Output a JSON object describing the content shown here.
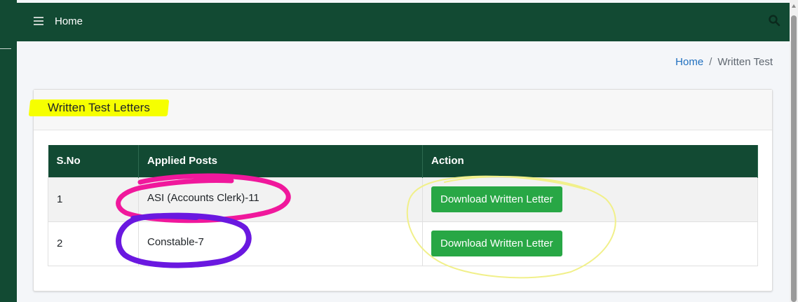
{
  "header": {
    "home_label": "Home"
  },
  "breadcrumb": {
    "home": "Home",
    "separator": "/",
    "current": "Written Test"
  },
  "card": {
    "title": "Written Test Letters",
    "table": {
      "columns": [
        "S.No",
        "Applied Posts",
        "Action"
      ],
      "rows": [
        {
          "sno": "1",
          "post": "ASI (Accounts Clerk)-11",
          "action": "Download Written Letter"
        },
        {
          "sno": "2",
          "post": "Constable-7",
          "action": "Download Written Letter"
        }
      ]
    }
  },
  "colors": {
    "primary_green": "#124a33",
    "button_green": "#28a745",
    "link_blue": "#1f6fbf",
    "highlight_yellow": "#f6ff00",
    "annotation_pink": "#f0189c",
    "annotation_purple": "#6a18e0",
    "annotation_yellow": "#f1f08a"
  },
  "icons": {
    "menu": "hamburger-menu-icon",
    "search": "search-icon"
  }
}
